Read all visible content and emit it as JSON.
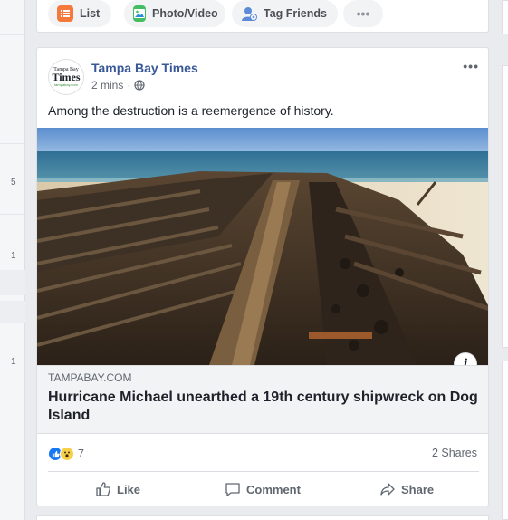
{
  "left_rail": {
    "counts": [
      "5",
      "1",
      "1"
    ]
  },
  "composer": {
    "list_label": "List",
    "photo_label": "Photo/Video",
    "tag_label": "Tag Friends",
    "more_label": "•••"
  },
  "post": {
    "avatar": {
      "line1": "Tampa Bay",
      "line2": "Times",
      "line3": "tampabay.com"
    },
    "page_name": "Tampa Bay Times",
    "time": "2 mins",
    "dot": "·",
    "menu_label": "•••",
    "text": "Among the destruction is a reemergence of history.",
    "photo_icon": "shipwreck-photo",
    "info_label": "i",
    "link": {
      "domain": "TAMPABAY.COM",
      "title": "Hurricane Michael unearthed a 19th century shipwreck on Dog Island"
    },
    "reactions": {
      "count": "7",
      "icons": [
        "like-reaction-icon",
        "wow-reaction-icon"
      ]
    },
    "shares": "2 Shares",
    "actions": {
      "like": "Like",
      "comment": "Comment",
      "share": "Share"
    }
  },
  "colors": {
    "page_name": "#385898",
    "like_blue": "#1877f2",
    "wow_yellow": "#f7d04b"
  }
}
